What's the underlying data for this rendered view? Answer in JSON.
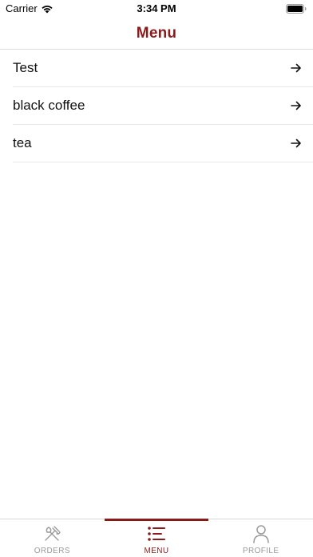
{
  "status_bar": {
    "carrier": "Carrier",
    "time": "3:34 PM"
  },
  "header": {
    "title": "Menu"
  },
  "menu": {
    "items": [
      {
        "label": "Test"
      },
      {
        "label": "black coffee"
      },
      {
        "label": "tea"
      }
    ]
  },
  "tabs": {
    "items": [
      {
        "label": "ORDERS",
        "icon": "fork-knife-icon",
        "active": false
      },
      {
        "label": "MENU",
        "icon": "menu-list-icon",
        "active": true
      },
      {
        "label": "PROFILE",
        "icon": "person-icon",
        "active": false
      }
    ]
  },
  "colors": {
    "accent": "#8b1a1a",
    "inactive": "#9a9a9a"
  }
}
